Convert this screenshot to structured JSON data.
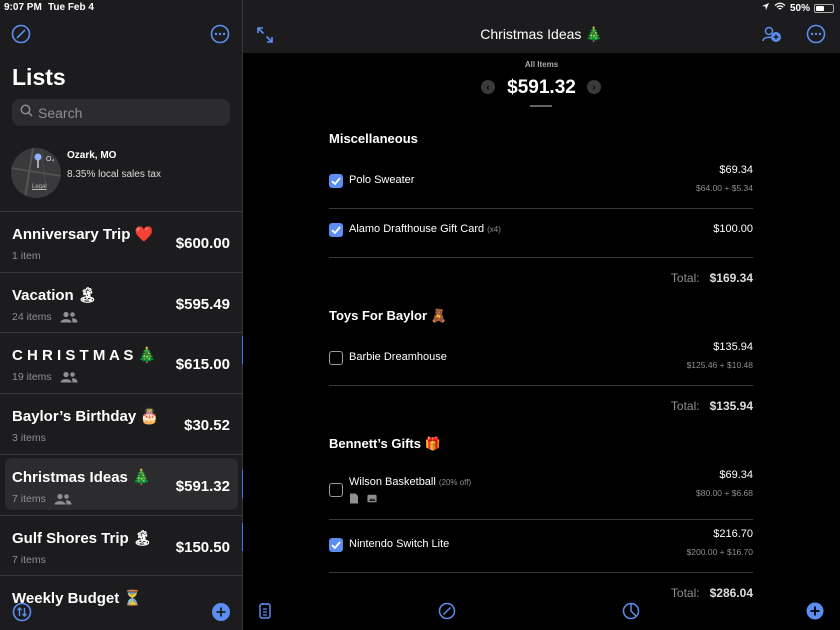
{
  "status_bar": {
    "time": "9:07 PM",
    "date": "Tue Feb 4",
    "battery": "50%",
    "battery_level": 0.5
  },
  "sidebar": {
    "title": "Lists",
    "search_placeholder": "Search",
    "location": {
      "city": "Ozark, MO",
      "tax": "8.35% local sales tax",
      "map_legal": "Legal"
    },
    "lists": [
      {
        "name": "Anniversary Trip ❤️",
        "meta": "1 item",
        "amount": "$600.00",
        "shared": false,
        "selected": false
      },
      {
        "name": "Vacation 🏝",
        "meta": "24 items",
        "amount": "$595.49",
        "shared": true,
        "selected": false
      },
      {
        "name": "C H R I S T M A S 🎄",
        "meta": "19 items",
        "amount": "$615.00",
        "shared": true,
        "selected": false
      },
      {
        "name": "Baylor’s Birthday 🎂",
        "meta": "3 items",
        "amount": "$30.52",
        "shared": false,
        "selected": false
      },
      {
        "name": "Christmas Ideas 🎄",
        "meta": "7 items",
        "amount": "$591.32",
        "shared": true,
        "selected": true
      },
      {
        "name": "Gulf Shores Trip 🏝",
        "meta": "7 items",
        "amount": "$150.50",
        "shared": false,
        "selected": false
      },
      {
        "name": "Weekly Budget ⏳",
        "meta": "",
        "amount": "",
        "shared": false,
        "selected": false
      }
    ]
  },
  "main": {
    "title": "Christmas Ideas 🎄",
    "summary_label": "All Items",
    "summary_total": "$591.32",
    "total_label": "Total:",
    "sections": [
      {
        "title": "Miscellaneous",
        "total": "$169.34",
        "items": [
          {
            "name": "Polo Sweater",
            "note": "",
            "checked": true,
            "price": "$69.34",
            "breakdown": "$64.00 + $5.34"
          },
          {
            "name": "Alamo Drafthouse Gift Card",
            "note": "(x4)",
            "checked": true,
            "price": "$100.00",
            "breakdown": ""
          }
        ]
      },
      {
        "title": "Toys For Baylor 🧸",
        "total": "$135.94",
        "items": [
          {
            "name": "Barbie Dreamhouse",
            "note": "",
            "checked": false,
            "price": "$135.94",
            "breakdown": "$125.46 + $10.48"
          }
        ]
      },
      {
        "title": "Bennett’s Gifts 🎁",
        "total": "$286.04",
        "items": [
          {
            "name": "Wilson Basketball",
            "note": "(20% off)",
            "checked": false,
            "price": "$69.34",
            "breakdown": "$80.00 + $6.68"
          },
          {
            "name": "Nintendo Switch Lite",
            "note": "",
            "checked": true,
            "price": "$216.70",
            "breakdown": "$200.00 + $16.70"
          }
        ]
      }
    ]
  },
  "colors": {
    "accent": "#3a7bf5",
    "icon_blue": "#5b8ef0",
    "sidebar_bg": "#1c1c1e",
    "main_bg": "#000000"
  }
}
